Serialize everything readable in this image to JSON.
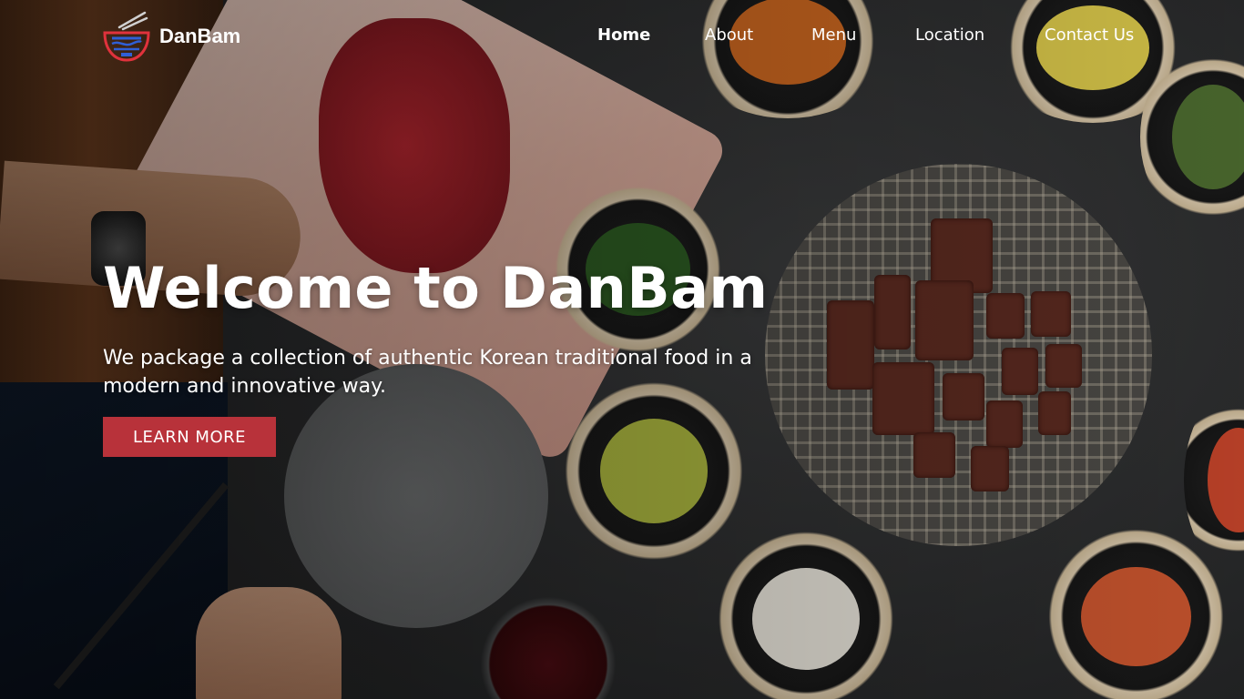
{
  "brand": {
    "name": "DanBam",
    "logo_icon": "ramen-bowl-chopsticks-icon"
  },
  "nav": {
    "items": [
      {
        "label": "Home",
        "active": true
      },
      {
        "label": "About",
        "active": false
      },
      {
        "label": "Menu",
        "active": false
      },
      {
        "label": "Location",
        "active": false
      },
      {
        "label": "Contact Us",
        "active": false
      }
    ]
  },
  "hero": {
    "title": "Welcome to DanBam",
    "subtitle": "We package a collection of authentic Korean traditional food in a modern and innovative way.",
    "cta_label": "LEARN MORE",
    "background_image": "korean-bbq-table-photo"
  },
  "colors": {
    "accent": "#b8323a",
    "text": "#ffffff",
    "logo_red": "#e0323c",
    "logo_blue": "#2f5fd6"
  }
}
